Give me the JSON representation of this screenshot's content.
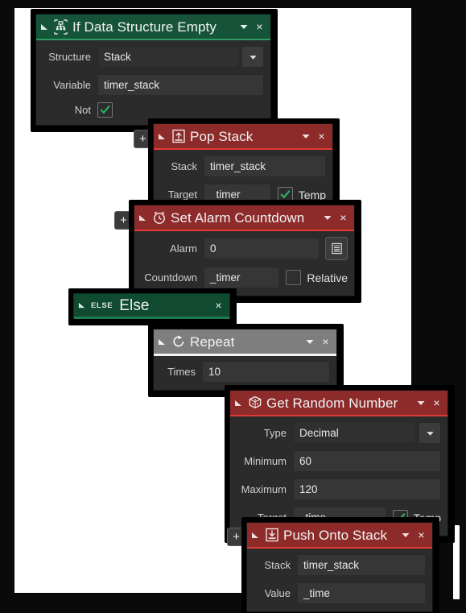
{
  "editor": {
    "canvas_background": "#ffffff",
    "panel_background": "#0a0a0a",
    "accent_green": "#16543a",
    "accent_red": "#8d2b2b",
    "accent_gray": "#7e7e7e"
  },
  "blocks": {
    "if_data_structure_empty": {
      "title": "If Data Structure Empty",
      "icon": "data-structure-icon",
      "header_color": "#16543a",
      "caret": "▾",
      "close": "×",
      "collapse": "◢",
      "rows": [
        {
          "label": "Structure",
          "value": "Stack",
          "type": "dropdown"
        },
        {
          "label": "Variable",
          "value": "timer_stack",
          "type": "text"
        },
        {
          "label": "Not",
          "value": "",
          "type": "checkbox",
          "checked": true
        }
      ]
    },
    "pop_stack": {
      "title": "Pop Stack",
      "icon": "pop-stack-icon",
      "header_color": "#8d2b2b",
      "caret": "▾",
      "close": "×",
      "collapse": "◢",
      "plus": "+",
      "rows": [
        {
          "label": "Stack",
          "value": "timer_stack",
          "type": "text"
        },
        {
          "label": "Target",
          "value": "_timer",
          "type": "text",
          "checkbox_label": "Temp",
          "checked": true
        }
      ]
    },
    "set_alarm_countdown": {
      "title": "Set Alarm Countdown",
      "icon": "alarm-clock-icon",
      "header_color": "#8d2b2b",
      "caret": "▾",
      "close": "×",
      "collapse": "◢",
      "plus": "+",
      "rows": [
        {
          "label": "Alarm",
          "value": "0",
          "type": "text",
          "button": "list-menu-icon"
        },
        {
          "label": "Countdown",
          "value": "_timer",
          "type": "text",
          "checkbox_label": "Relative",
          "checked": false
        }
      ]
    },
    "else": {
      "title": "Else",
      "tag": "ELSE",
      "header_color": "#0f4a31",
      "close": "×",
      "collapse": "◢"
    },
    "repeat": {
      "title": "Repeat",
      "icon": "repeat-icon",
      "header_color": "#7e7e7e",
      "caret": "▾",
      "close": "×",
      "collapse": "◢",
      "rows": [
        {
          "label": "Times",
          "value": "10",
          "type": "text"
        }
      ]
    },
    "get_random_number": {
      "title": "Get Random Number",
      "icon": "dice-icon",
      "header_color": "#8d2b2b",
      "caret": "▾",
      "close": "×",
      "collapse": "◢",
      "rows": [
        {
          "label": "Type",
          "value": "Decimal",
          "type": "dropdown"
        },
        {
          "label": "Minimum",
          "value": "60",
          "type": "text"
        },
        {
          "label": "Maximum",
          "value": "120",
          "type": "text"
        },
        {
          "label": "Target",
          "value": "_time",
          "type": "text",
          "checkbox_label": "Temp",
          "checked": true
        }
      ]
    },
    "push_onto_stack": {
      "title": "Push Onto Stack",
      "icon": "push-stack-icon",
      "header_color": "#8d2b2b",
      "caret": "▾",
      "close": "×",
      "collapse": "◢",
      "plus": "+",
      "rows": [
        {
          "label": "Stack",
          "value": "timer_stack",
          "type": "text"
        },
        {
          "label": "Value",
          "value": "_time",
          "type": "text"
        }
      ]
    }
  }
}
